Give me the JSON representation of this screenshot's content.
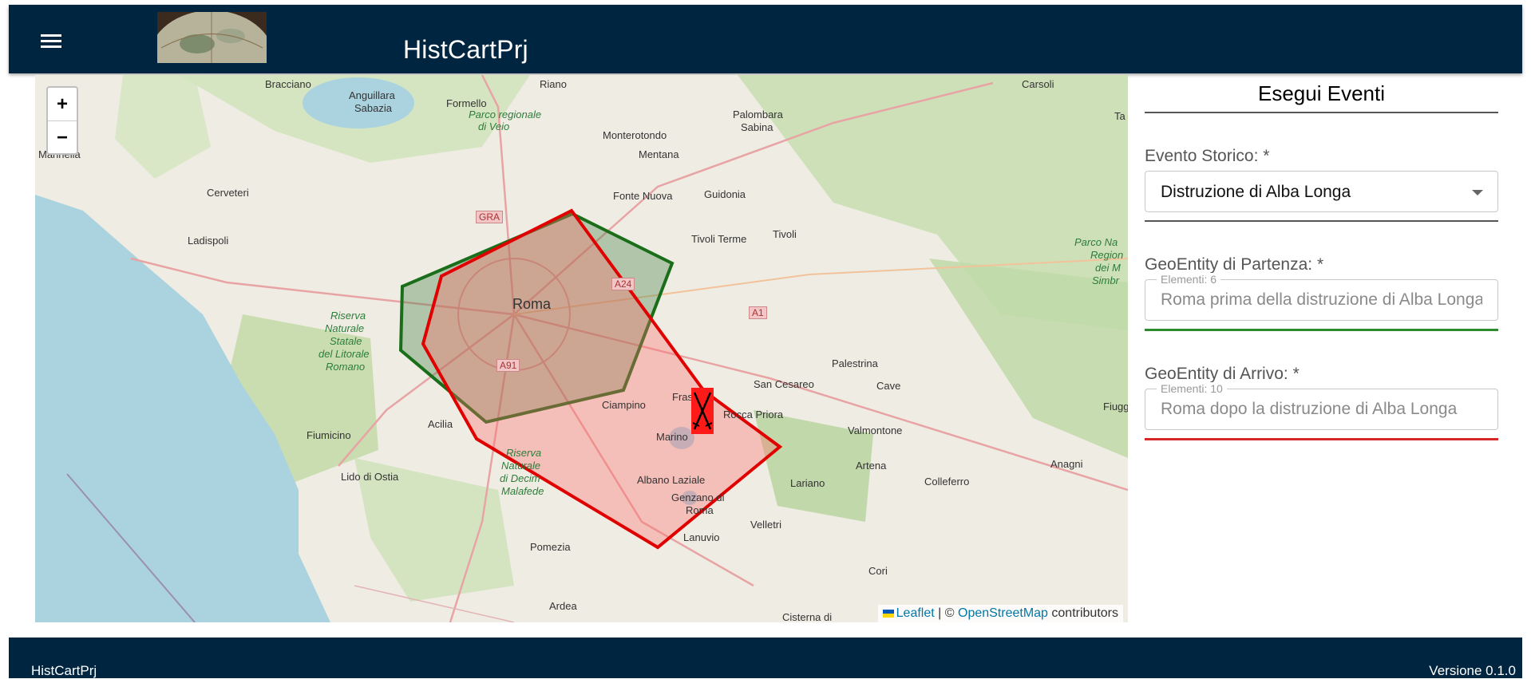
{
  "header": {
    "title": "HistCartPrj",
    "menu_icon": "hamburger-menu-icon",
    "logo": "globe-logo"
  },
  "map": {
    "zoom_in": "+",
    "zoom_out": "−",
    "places": {
      "roma": "Roma",
      "bracciano": "Bracciano",
      "anguillara": "Anguillara",
      "sabazia": "Sabazia",
      "formello": "Formello",
      "riano": "Riano",
      "parco_veio_1": "Parco regionale",
      "parco_veio_2": "di Veio",
      "monterotondo": "Monterotondo",
      "mentana": "Mentana",
      "palombara": "Palombara",
      "sabina": "Sabina",
      "carsoli": "Carsoli",
      "marinella": "Marinella",
      "cerveteri": "Cerveteri",
      "ladispoli": "Ladispoli",
      "fonte_nuova": "Fonte Nuova",
      "guidonia": "Guidonia",
      "tivoli_terme": "Tivoli Terme",
      "tivoli": "Tivoli",
      "riserva_1": "Riserva",
      "riserva_2": "Naturale",
      "riserva_3": "Statale",
      "riserva_4": "del Litorale",
      "riserva_5": "Romano",
      "fiumicino": "Fiumicino",
      "acilia": "Acilia",
      "lido": "Lido di Ostia",
      "ciampino": "Ciampino",
      "frascati": "Fras",
      "rocca_priora": "Rocca Priora",
      "marino": "Marino",
      "albano": "Albano Laziale",
      "genzano_1": "Genzano di",
      "genzano_2": "Roma",
      "lanuvio": "Lanuvio",
      "velletri": "Velletri",
      "pomezia": "Pomezia",
      "ardea": "Ardea",
      "cisterna": "Cisterna di",
      "lariano": "Lariano",
      "artena": "Artena",
      "colleferro": "Colleferro",
      "anagni": "Anagni",
      "valmontone": "Valmontone",
      "cave": "Cave",
      "palestrina": "Palestrina",
      "san_cesareo": "San Cesareo",
      "cori": "Cori",
      "fiugg": "Fiugg",
      "riserva_decima_1": "Riserva",
      "riserva_decima_2": "Naturale",
      "riserva_decima_3": "di Decim",
      "riserva_decima_4": "Malafede",
      "parco_na_1": "Parco Na",
      "parco_na_2": "Region",
      "parco_na_3": "dei M",
      "parco_na_4": "Simbr",
      "tag": "Ta"
    },
    "shields": {
      "gra": "GRA",
      "a24": "A24",
      "a1": "A1",
      "a91": "A91"
    },
    "polygons": {
      "green_color": "#1a6e1a",
      "red_color": "#e00000",
      "red_fill": "#ff6b6b"
    },
    "attribution": {
      "leaflet": "Leaflet",
      "sep": "| ©",
      "osm": "OpenStreetMap",
      "contributors": "contributors"
    }
  },
  "panel": {
    "title": "Esegui Eventi",
    "evento_label": "Evento Storico: *",
    "evento_value": "Distruzione di Alba Longa",
    "partenza_label": "GeoEntity di Partenza: *",
    "partenza_count": "Elementi: 6",
    "partenza_placeholder": "Roma prima della distruzione di Alba Longa",
    "arrivo_label": "GeoEntity di Arrivo: *",
    "arrivo_count": "Elementi: 10",
    "arrivo_placeholder": "Roma dopo la distruzione di Alba Longa"
  },
  "footer": {
    "left": "HistCartPrj",
    "right": "Versione 0.1.0"
  }
}
